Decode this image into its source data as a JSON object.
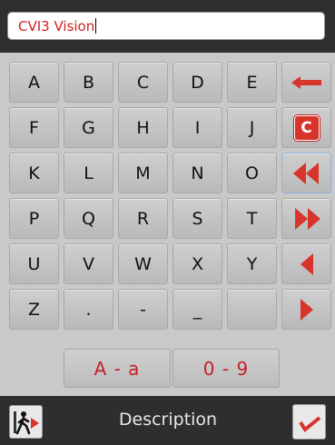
{
  "input": {
    "value": "CVI3 Vision"
  },
  "keys": {
    "row1": [
      "A",
      "B",
      "C",
      "D",
      "E"
    ],
    "row2": [
      "F",
      "G",
      "H",
      "I",
      "J"
    ],
    "row3": [
      "K",
      "L",
      "M",
      "N",
      "O"
    ],
    "row4": [
      "P",
      "Q",
      "R",
      "S",
      "T"
    ],
    "row5": [
      "U",
      "V",
      "W",
      "X",
      "Y"
    ],
    "row6": [
      "Z",
      ".",
      "-",
      "_",
      ""
    ]
  },
  "clear_label": "C",
  "mode": {
    "case_label": "A - a",
    "digits_label": "0 - 9"
  },
  "footer": {
    "title": "Description"
  },
  "colors": {
    "accent": "#d9342b",
    "bar": "#2e2e2e",
    "keyboard": "#c9c9c9"
  },
  "icons": {
    "backspace": "left-arrow-icon",
    "clear": "clear-icon",
    "start": "double-left-icon",
    "end": "double-right-icon",
    "left": "left-triangle-icon",
    "right": "right-triangle-icon",
    "exit": "exit-icon",
    "confirm": "check-icon"
  }
}
